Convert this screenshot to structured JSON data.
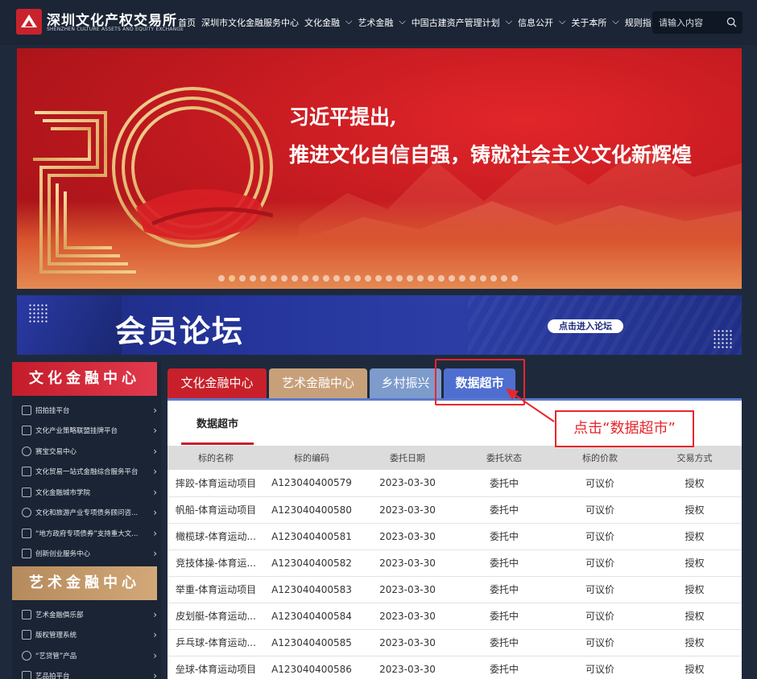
{
  "header": {
    "logo_cn": "深圳文化产权交易所",
    "logo_en": "SHENZHEN CULTURE ASSETS AND EQUITY EXCHANGE",
    "nav": [
      {
        "label": "首页",
        "dropdown": false
      },
      {
        "label": "深圳市文化金融服务中心",
        "dropdown": false
      },
      {
        "label": "文化金融",
        "dropdown": true
      },
      {
        "label": "艺术金融",
        "dropdown": true
      },
      {
        "label": "中国古建资产管理计划",
        "dropdown": true
      },
      {
        "label": "信息公开",
        "dropdown": true
      },
      {
        "label": "关于本所",
        "dropdown": true
      },
      {
        "label": "规则指引",
        "dropdown": true
      }
    ],
    "search_placeholder": "请输入内容"
  },
  "banner": {
    "line1": "习近平提出,",
    "line2": "推进文化自信自强，铸就社会主义文化新辉煌",
    "slide_count": 29,
    "active_slide": 2
  },
  "forum": {
    "title": "会员论坛",
    "button": "点击进入论坛"
  },
  "sidebar": {
    "culture_title": "文化金融中心",
    "culture_items": [
      "招拍挂平台",
      "文化产业策略联盟挂牌平台",
      "赛宝交易中心",
      "文化贸易一站式金融综合服务平台",
      "文化金融城市学院",
      "文化和旅游产业专项债务顾问咨...",
      "“地方政府专项债券”支持重大文...",
      "创新创业服务中心"
    ],
    "art_title": "艺术金融中心",
    "art_items": [
      "艺术金融俱乐部",
      "版权管理系统",
      "“艺贷管”产品",
      "艺品拍平台"
    ]
  },
  "tabs": [
    {
      "label": "文化金融中心"
    },
    {
      "label": "艺术金融中心"
    },
    {
      "label": "乡村振兴"
    },
    {
      "label": "数据超市"
    }
  ],
  "panel": {
    "subtab": "数据超市",
    "columns": [
      "标的名称",
      "标的编码",
      "委托日期",
      "委托状态",
      "标的价款",
      "交易方式"
    ],
    "rows": [
      [
        "摔跤-体育运动项目",
        "A123040400579",
        "2023-03-30",
        "委托中",
        "可议价",
        "授权"
      ],
      [
        "帆船-体育运动项目",
        "A123040400580",
        "2023-03-30",
        "委托中",
        "可议价",
        "授权"
      ],
      [
        "橄榄球-体育运动...",
        "A123040400581",
        "2023-03-30",
        "委托中",
        "可议价",
        "授权"
      ],
      [
        "竞技体操-体育运...",
        "A123040400582",
        "2023-03-30",
        "委托中",
        "可议价",
        "授权"
      ],
      [
        "举重-体育运动项目",
        "A123040400583",
        "2023-03-30",
        "委托中",
        "可议价",
        "授权"
      ],
      [
        "皮划艇-体育运动...",
        "A123040400584",
        "2023-03-30",
        "委托中",
        "可议价",
        "授权"
      ],
      [
        "乒乓球-体育运动...",
        "A123040400585",
        "2023-03-30",
        "委托中",
        "可议价",
        "授权"
      ],
      [
        "垒球-体育运动项目",
        "A123040400586",
        "2023-03-30",
        "委托中",
        "可议价",
        "授权"
      ]
    ]
  },
  "annotation": {
    "callout": "点击“数据超市”",
    "color": "#e8262b"
  }
}
